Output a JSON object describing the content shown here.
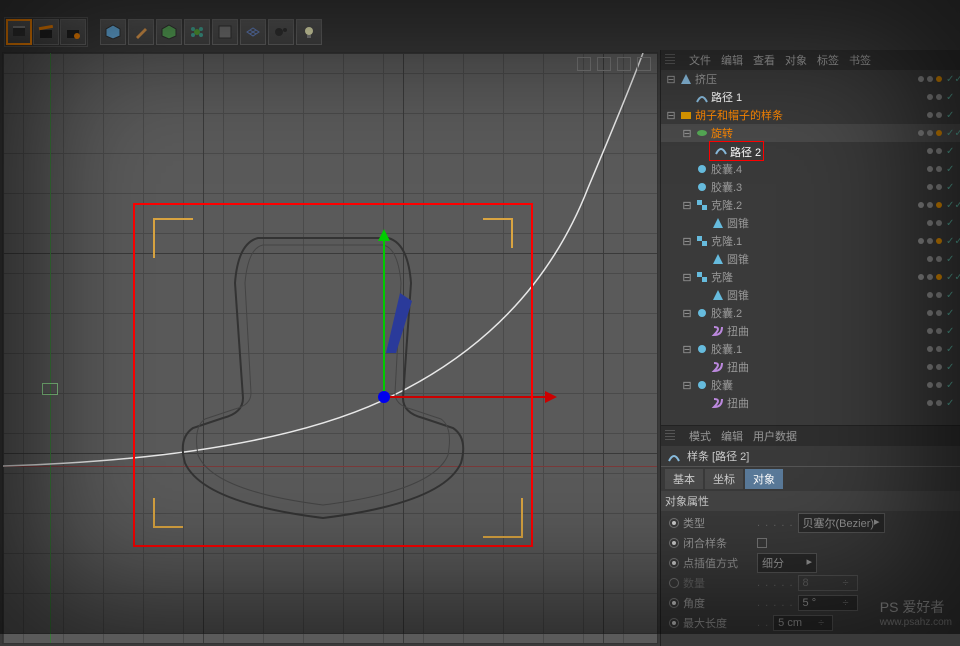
{
  "toolbar": {
    "icons": [
      "director",
      "clapper",
      "clapper-gear",
      "cube",
      "pen",
      "green-cube",
      "flower",
      "panel",
      "grid",
      "particle",
      "light"
    ]
  },
  "right_tabs": [
    "文件",
    "编辑",
    "查看",
    "对象",
    "标签",
    "书签"
  ],
  "tree": [
    {
      "d": 0,
      "exp": "-",
      "icon": "extrude",
      "color": "#8bd",
      "label": "挤压",
      "cls": "",
      "chk": 2
    },
    {
      "d": 1,
      "exp": "",
      "icon": "spline",
      "color": "#8bd",
      "label": "路径 1",
      "cls": "white",
      "chk": 1
    },
    {
      "d": 0,
      "exp": "-",
      "icon": "layer",
      "color": "#d90",
      "label": "胡子和帽子的样条",
      "cls": "orange",
      "chk": 1
    },
    {
      "d": 1,
      "exp": "-",
      "icon": "lathe",
      "color": "#5a5",
      "label": "旋转",
      "cls": "orange",
      "chk": 2,
      "sel": true
    },
    {
      "d": 2,
      "exp": "",
      "icon": "spline",
      "color": "#8bd",
      "label": "路径 2",
      "cls": "white",
      "chk": 1,
      "hl": true
    },
    {
      "d": 1,
      "exp": "",
      "icon": "capsule",
      "color": "#6bd",
      "label": "胶囊.4",
      "cls": "",
      "chk": 1
    },
    {
      "d": 1,
      "exp": "",
      "icon": "capsule",
      "color": "#6bd",
      "label": "胶囊.3",
      "cls": "",
      "chk": 1
    },
    {
      "d": 1,
      "exp": "-",
      "icon": "cloner",
      "color": "#6bd",
      "label": "克隆.2",
      "cls": "",
      "chk": 2
    },
    {
      "d": 2,
      "exp": "",
      "icon": "cone",
      "color": "#6bd",
      "label": "圆锥",
      "cls": "",
      "chk": 1
    },
    {
      "d": 1,
      "exp": "-",
      "icon": "cloner",
      "color": "#6bd",
      "label": "克隆.1",
      "cls": "",
      "chk": 2
    },
    {
      "d": 2,
      "exp": "",
      "icon": "cone",
      "color": "#6bd",
      "label": "圆锥",
      "cls": "",
      "chk": 1
    },
    {
      "d": 1,
      "exp": "-",
      "icon": "cloner",
      "color": "#6bd",
      "label": "克隆",
      "cls": "",
      "chk": 2
    },
    {
      "d": 2,
      "exp": "",
      "icon": "cone",
      "color": "#6bd",
      "label": "圆锥",
      "cls": "",
      "chk": 1
    },
    {
      "d": 1,
      "exp": "-",
      "icon": "capsule",
      "color": "#6bd",
      "label": "胶囊.2",
      "cls": "",
      "chk": 1
    },
    {
      "d": 2,
      "exp": "",
      "icon": "twist",
      "color": "#b8d",
      "label": "扭曲",
      "cls": "",
      "chk": 1
    },
    {
      "d": 1,
      "exp": "-",
      "icon": "capsule",
      "color": "#6bd",
      "label": "胶囊.1",
      "cls": "",
      "chk": 1
    },
    {
      "d": 2,
      "exp": "",
      "icon": "twist",
      "color": "#b8d",
      "label": "扭曲",
      "cls": "",
      "chk": 1
    },
    {
      "d": 1,
      "exp": "-",
      "icon": "capsule",
      "color": "#6bd",
      "label": "胶囊",
      "cls": "",
      "chk": 1
    },
    {
      "d": 2,
      "exp": "",
      "icon": "twist",
      "color": "#b8d",
      "label": "扭曲",
      "cls": "",
      "chk": 1
    }
  ],
  "attr_tabs2": [
    "模式",
    "编辑",
    "用户数据"
  ],
  "attr_title": "样条 [路径 2]",
  "attr_subtabs": {
    "basic": "基本",
    "coord": "坐标",
    "obj": "对象"
  },
  "attr_section": "对象属性",
  "attrs": {
    "type_l": "类型",
    "type_v": "贝塞尔(Bezier)",
    "close_l": "闭合样条",
    "interp_l": "点插值方式",
    "interp_v": "细分",
    "count_l": "数量",
    "count_v": "8",
    "angle_l": "角度",
    "angle_v": "5 °",
    "maxlen_l": "最大长度",
    "maxlen_v": "5 cm"
  },
  "watermark": {
    "t": "PS 爱好者",
    "u": "www.psahz.com"
  }
}
